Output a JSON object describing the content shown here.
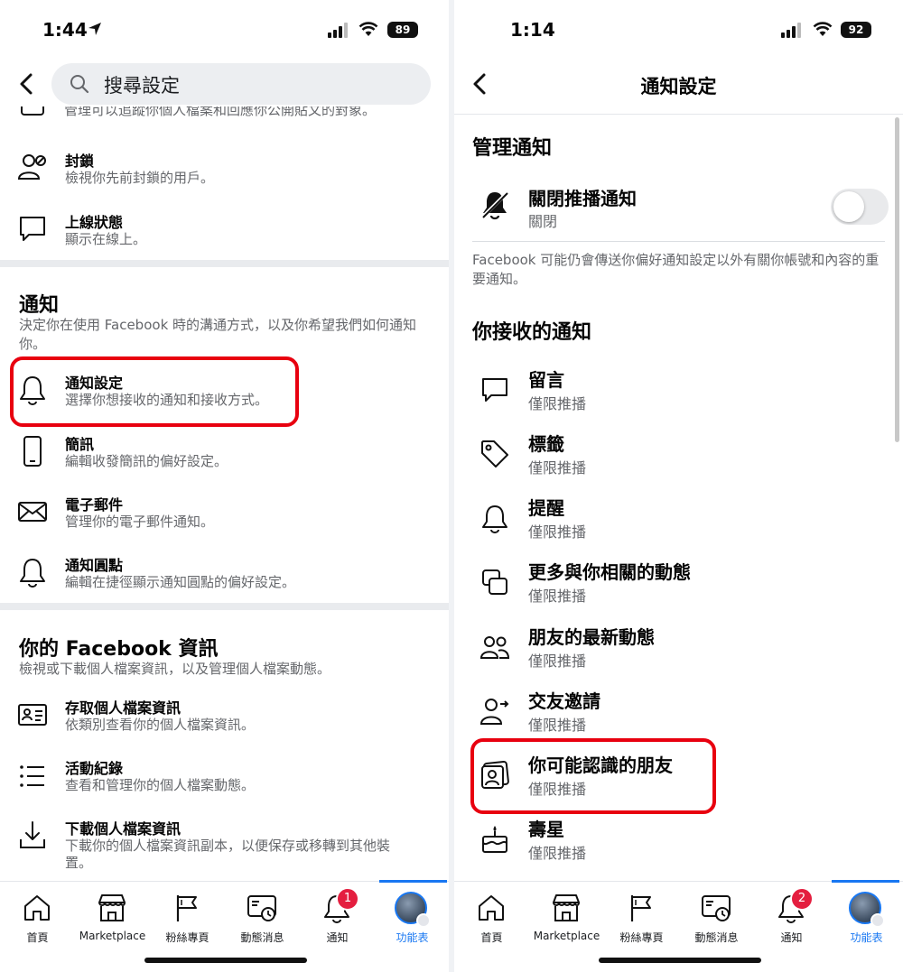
{
  "left": {
    "status": {
      "time": "1:44",
      "battery": "89"
    },
    "search": {
      "placeholder": "搜尋設定"
    },
    "cut_row": {
      "text": "管理可以追蹤你個人檔案和回應你公開貼文的對象。"
    },
    "rows_top": [
      {
        "title": "封鎖",
        "subtitle": "檢視你先前封鎖的用戶。",
        "icon": "blocked-user-icon"
      },
      {
        "title": "上線狀態",
        "subtitle": "顯示在線上。",
        "icon": "chat-bubble-icon"
      }
    ],
    "notifications_section": {
      "title": "通知",
      "description": "決定你在使用 Facebook 時的溝通方式，以及你希望我們如何通知你。",
      "rows": [
        {
          "title": "通知設定",
          "subtitle": "選擇你想接收的通知和接收方式。",
          "icon": "bell-icon"
        },
        {
          "title": "簡訊",
          "subtitle": "編輯收發簡訊的偏好設定。",
          "icon": "phone-icon"
        },
        {
          "title": "電子郵件",
          "subtitle": "管理你的電子郵件通知。",
          "icon": "envelope-icon"
        },
        {
          "title": "通知圓點",
          "subtitle": "編輯在捷徑顯示通知圓點的偏好設定。",
          "icon": "bell-icon"
        }
      ]
    },
    "info_section": {
      "title": "你的 Facebook 資訊",
      "description": "檢視或下載個人檔案資訊，以及管理個人檔案動態。",
      "rows": [
        {
          "title": "存取個人檔案資訊",
          "subtitle": "依類別查看你的個人檔案資訊。",
          "icon": "id-card-icon"
        },
        {
          "title": "活動紀錄",
          "subtitle": "查看和管理你的個人檔案動態。",
          "icon": "list-icon"
        },
        {
          "title": "下載個人檔案資訊",
          "subtitle": "下載你的個人檔案資訊副本，以便保存或移轉到其他裝",
          "subtitle2": "置。",
          "icon": "download-icon"
        }
      ]
    },
    "tabs": [
      {
        "label": "首頁",
        "icon": "home-icon"
      },
      {
        "label": "Marketplace",
        "icon": "marketplace-icon"
      },
      {
        "label": "粉絲專頁",
        "icon": "flag-icon"
      },
      {
        "label": "動態消息",
        "icon": "news-feed-icon"
      },
      {
        "label": "通知",
        "icon": "bell-icon",
        "badge": "1"
      },
      {
        "label": "功能表",
        "icon": "avatar-menu-icon"
      }
    ]
  },
  "right": {
    "status": {
      "time": "1:14",
      "battery": "92"
    },
    "header": {
      "title": "通知設定"
    },
    "manage_section": {
      "title": "管理通知"
    },
    "push_row": {
      "title": "關閉推播通知",
      "subtitle": "關閉",
      "icon": "bell-off-icon",
      "toggle_on": false
    },
    "note": "Facebook 可能仍會傳送你偏好通知設定以外有關你帳號和內容的重要通知。",
    "receive_section": {
      "title": "你接收的通知"
    },
    "rows": [
      {
        "title": "留言",
        "subtitle": "僅限推播",
        "icon": "comment-icon"
      },
      {
        "title": "標籤",
        "subtitle": "僅限推播",
        "icon": "tag-icon"
      },
      {
        "title": "提醒",
        "subtitle": "僅限推播",
        "icon": "bell-icon"
      },
      {
        "title": "更多與你相關的動態",
        "subtitle": "僅限推播",
        "icon": "stacked-cards-icon"
      },
      {
        "title": "朋友的最新動態",
        "subtitle": "僅限推播",
        "icon": "friends-icon"
      },
      {
        "title": "交友邀請",
        "subtitle": "僅限推播",
        "icon": "add-friend-icon"
      },
      {
        "title": "你可能認識的朋友",
        "subtitle": "僅限推播",
        "icon": "people-you-may-know-icon"
      },
      {
        "title": "壽星",
        "subtitle": "僅限推播",
        "icon": "birthday-cake-icon"
      }
    ],
    "tabs": [
      {
        "label": "首頁",
        "icon": "home-icon"
      },
      {
        "label": "Marketplace",
        "icon": "marketplace-icon"
      },
      {
        "label": "粉絲專頁",
        "icon": "flag-icon"
      },
      {
        "label": "動態消息",
        "icon": "news-feed-icon"
      },
      {
        "label": "通知",
        "icon": "bell-icon",
        "badge": "2"
      },
      {
        "label": "功能表",
        "icon": "avatar-menu-icon"
      }
    ]
  },
  "colors": {
    "accent": "#1877f2",
    "highlight": "#e8000f",
    "badge": "#e41e3f",
    "secondary_text": "#65676b"
  }
}
